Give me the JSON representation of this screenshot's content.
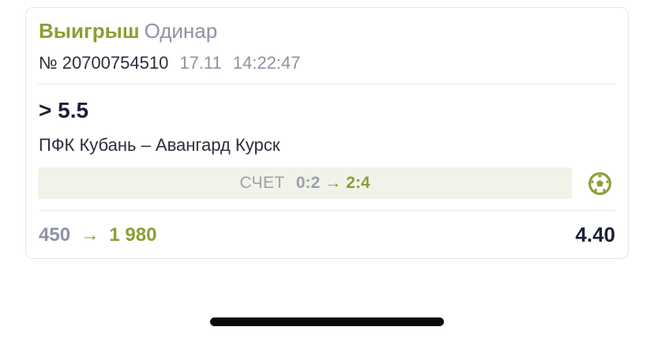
{
  "bet": {
    "status": "Выигрыш",
    "type": "Одинар",
    "ticket": "№ 20700754510",
    "date": "17.11",
    "time": "14:22:47",
    "selection": "> 5.5",
    "event": "ПФК Кубань – Авангард Курск",
    "score_label": "СЧЕТ",
    "score_from": "0:2",
    "score_arrow": "→",
    "score_to": "2:4",
    "stake": "450",
    "payout_arrow": "→",
    "payout": "1 980",
    "odds": "4.40",
    "sport_icon": "soccer-ball-icon"
  },
  "colors": {
    "win": "#8a9f35",
    "muted": "#8c93a3",
    "dark": "#1b2135",
    "score_bg": "#f1f3e9"
  }
}
